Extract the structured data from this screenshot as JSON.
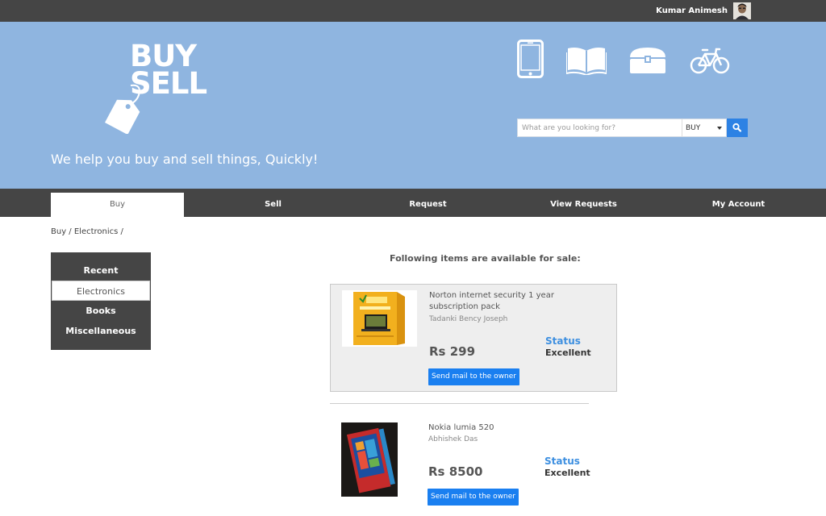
{
  "user": {
    "name": "Kumar Animesh"
  },
  "logo": {
    "line1": "BUY",
    "line2": "SELL"
  },
  "tagline": "We help you buy and sell things, Quickly!",
  "categories_icons": [
    "phone-icon",
    "book-icon",
    "chest-icon",
    "bicycle-icon"
  ],
  "search": {
    "placeholder": "What are you looking for?",
    "mode": "BUY",
    "button_icon": "search-icon"
  },
  "nav": {
    "tabs": [
      {
        "label": "Buy"
      },
      {
        "label": "Sell"
      },
      {
        "label": "Request"
      },
      {
        "label": "View Requests"
      },
      {
        "label": "My Account"
      }
    ]
  },
  "breadcrumb": "Buy / Electronics /",
  "side_menu": {
    "items": [
      {
        "label": "Recent"
      },
      {
        "label": "Electronics"
      },
      {
        "label": "Books"
      },
      {
        "label": "Miscellaneous"
      }
    ]
  },
  "listing": {
    "heading": "Following items are available for sale:",
    "items": [
      {
        "title": "Norton internet security 1 year subscription pack",
        "owner": "Tadanki Bency Joseph",
        "price": "Rs 299",
        "status_label": "Status",
        "status_value": "Excellent",
        "button": "Send mail to the owner"
      },
      {
        "title": "Nokia lumia 520",
        "owner": "Abhishek Das",
        "price": "Rs 8500",
        "status_label": "Status",
        "status_value": "Excellent",
        "button": "Send mail to the owner"
      }
    ]
  },
  "colors": {
    "header_bg": "#8fb5e0",
    "bar_bg": "#454545",
    "accent": "#1a7ff0",
    "status": "#3d8fe0"
  }
}
